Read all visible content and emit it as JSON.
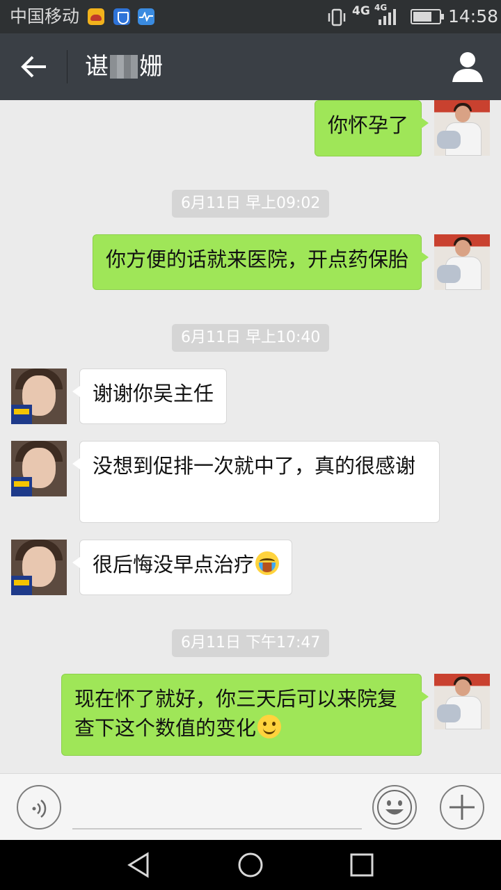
{
  "status_bar": {
    "carrier": "中国移动",
    "network_primary": "4G",
    "network_secondary": "4G",
    "time": "14:58",
    "icons": [
      "app-notification-icon",
      "shield-notification-icon",
      "health-notification-icon",
      "vibrate-icon",
      "signal-icon",
      "battery-icon"
    ]
  },
  "header": {
    "title_prefix": "谌",
    "title_suffix": "姗",
    "back_icon": "arrow-left-icon",
    "profile_icon": "person-icon"
  },
  "messages": [
    {
      "type": "out",
      "text": "你怀孕了"
    },
    {
      "type": "time",
      "text": "6月11日 早上09:02"
    },
    {
      "type": "out",
      "text": "你方便的话就来医院，开点药保胎"
    },
    {
      "type": "time",
      "text": "6月11日 早上10:40"
    },
    {
      "type": "in",
      "text": "谢谢你吴主任"
    },
    {
      "type": "in",
      "text": "没想到促排一次就中了，真的很感谢"
    },
    {
      "type": "in",
      "text": "很后悔没早点治疗",
      "emoji": "crying-emoji"
    },
    {
      "type": "time",
      "text": "6月11日 下午17:47"
    },
    {
      "type": "out",
      "text": "现在怀了就好，你三天后可以来院复查下这个数值的变化",
      "emoji": "smile-emoji"
    }
  ],
  "input_bar": {
    "value": "",
    "placeholder": "",
    "icons": [
      "voice-icon",
      "emoji-icon",
      "plus-icon"
    ]
  },
  "nav_bar": {
    "icons": [
      "nav-back-icon",
      "nav-home-icon",
      "nav-recent-icon"
    ]
  },
  "colors": {
    "outgoing_bubble": "#9fe658",
    "incoming_bubble": "#ffffff",
    "chat_background": "#ebebeb",
    "header_background": "#3a3f45",
    "status_bar_background": "#2e3133",
    "time_label_background": "#d5d5d5"
  }
}
